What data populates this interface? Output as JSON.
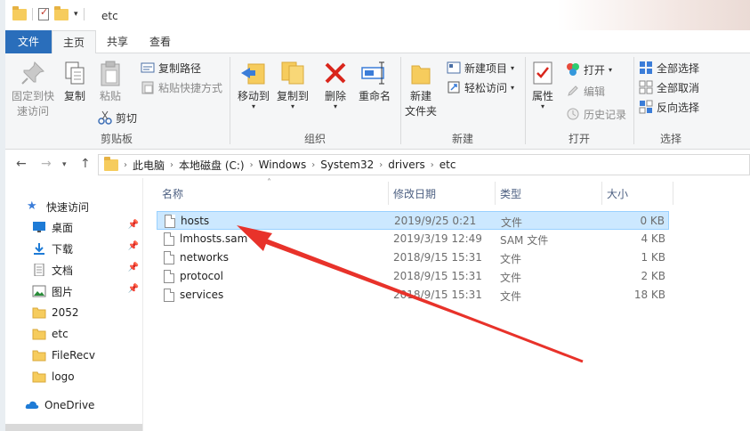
{
  "window": {
    "title": "etc"
  },
  "tabs": [
    {
      "label": "文件"
    },
    {
      "label": "主页"
    },
    {
      "label": "共享"
    },
    {
      "label": "查看"
    }
  ],
  "ribbon": {
    "clipboard": {
      "label": "剪贴板",
      "pin_quick": "固定到快\n速访问",
      "copy": "复制",
      "paste": "粘贴",
      "copy_path": "复制路径",
      "paste_shortcut": "粘贴快捷方式",
      "cut": "剪切"
    },
    "organize": {
      "label": "组织",
      "move_to": "移动到",
      "copy_to": "复制到",
      "delete": "删除",
      "rename": "重命名"
    },
    "new": {
      "label": "新建",
      "new_folder": "新建\n文件夹",
      "new_item": "新建项目",
      "easy_access": "轻松访问"
    },
    "open": {
      "label": "打开",
      "properties": "属性",
      "open": "打开",
      "edit": "编辑",
      "history": "历史记录"
    },
    "select": {
      "label": "选择",
      "select_all": "全部选择",
      "select_none": "全部取消",
      "invert": "反向选择"
    }
  },
  "address": {
    "crumbs": [
      "此电脑",
      "本地磁盘 (C:)",
      "Windows",
      "System32",
      "drivers",
      "etc"
    ]
  },
  "navpane": {
    "quick_access": "快速访问",
    "items": [
      {
        "label": "桌面",
        "pinned": true
      },
      {
        "label": "下载",
        "pinned": true
      },
      {
        "label": "文档",
        "pinned": true
      },
      {
        "label": "图片",
        "pinned": true
      },
      {
        "label": "2052",
        "pinned": false
      },
      {
        "label": "etc",
        "pinned": false
      },
      {
        "label": "FileRecv",
        "pinned": false
      },
      {
        "label": "logo",
        "pinned": false
      }
    ],
    "onedrive": "OneDrive"
  },
  "filelist": {
    "columns": {
      "name": "名称",
      "date": "修改日期",
      "type": "类型",
      "size": "大小"
    },
    "rows": [
      {
        "name": "hosts",
        "date": "2019/9/25 0:21",
        "type": "文件",
        "size": "0 KB",
        "selected": true
      },
      {
        "name": "lmhosts.sam",
        "date": "2019/3/19 12:49",
        "type": "SAM 文件",
        "size": "4 KB",
        "selected": false
      },
      {
        "name": "networks",
        "date": "2018/9/15 15:31",
        "type": "文件",
        "size": "1 KB",
        "selected": false
      },
      {
        "name": "protocol",
        "date": "2018/9/15 15:31",
        "type": "文件",
        "size": "2 KB",
        "selected": false
      },
      {
        "name": "services",
        "date": "2018/9/15 15:31",
        "type": "文件",
        "size": "18 KB",
        "selected": false
      }
    ]
  },
  "colors": {
    "file_tab": "#2a6ebb",
    "selection": "#cce8ff",
    "annotation_arrow": "#e8322a"
  }
}
